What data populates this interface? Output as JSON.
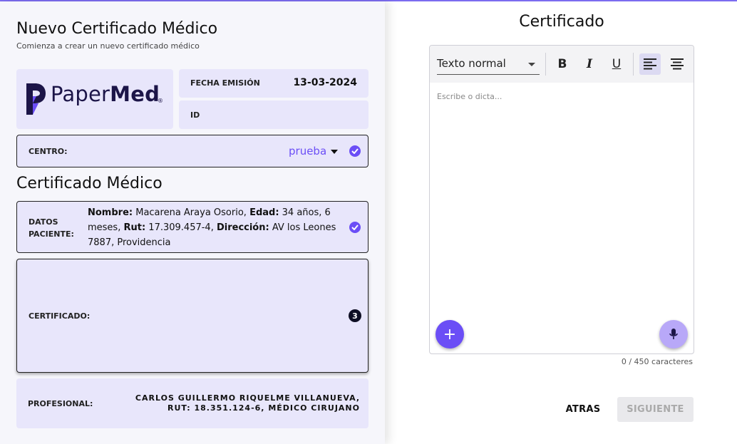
{
  "header": {
    "title": "Nuevo Certificado Médico",
    "subtitle": "Comienza a crear un nuevo certificado médico"
  },
  "logo": {
    "brand_light": "Paper",
    "brand_bold": "Med",
    "registered": "®"
  },
  "fecha": {
    "label": "FECHA EMISIÓN",
    "value": "13-03-2024"
  },
  "id_field": {
    "label": "ID",
    "value": ""
  },
  "centro": {
    "label": "CENTRO:",
    "value": "prueba"
  },
  "section_title": "Certificado Médico",
  "paciente": {
    "label_line1": "DATOS",
    "label_line2": "PACIENTE:",
    "nombre_label": "Nombre:",
    "nombre": " Macarena Araya Osorio, ",
    "edad_label": "Edad:",
    "edad": " 34 años, 6 meses, ",
    "rut_label": "Rut:",
    "rut": " 17.309.457-4, ",
    "direccion_label": "Dirección:",
    "direccion": " AV los Leones 7887, Providencia"
  },
  "certificado": {
    "label": "CERTIFICADO:",
    "badge": "3"
  },
  "profesional": {
    "label": "PROFESIONAL:",
    "line1": "CARLOS GUILLERMO RIQUELME VILLANUEVA,",
    "line2": "RUT: 18.351.124-6, MÉDICO CIRUJANO"
  },
  "editor": {
    "title": "Certificado",
    "format_select": "Texto normal",
    "bold": "B",
    "italic": "I",
    "underline": "U",
    "placeholder": "Escribe o dicta...",
    "counter": "0 / 450 caracteres"
  },
  "actions": {
    "back": "ATRAS",
    "next": "SIGUIENTE"
  },
  "colors": {
    "accent": "#6b4ef6",
    "card_bg": "#e8e6fb",
    "brand_dark": "#1c1548",
    "mic_bg": "#b8a8f8"
  }
}
